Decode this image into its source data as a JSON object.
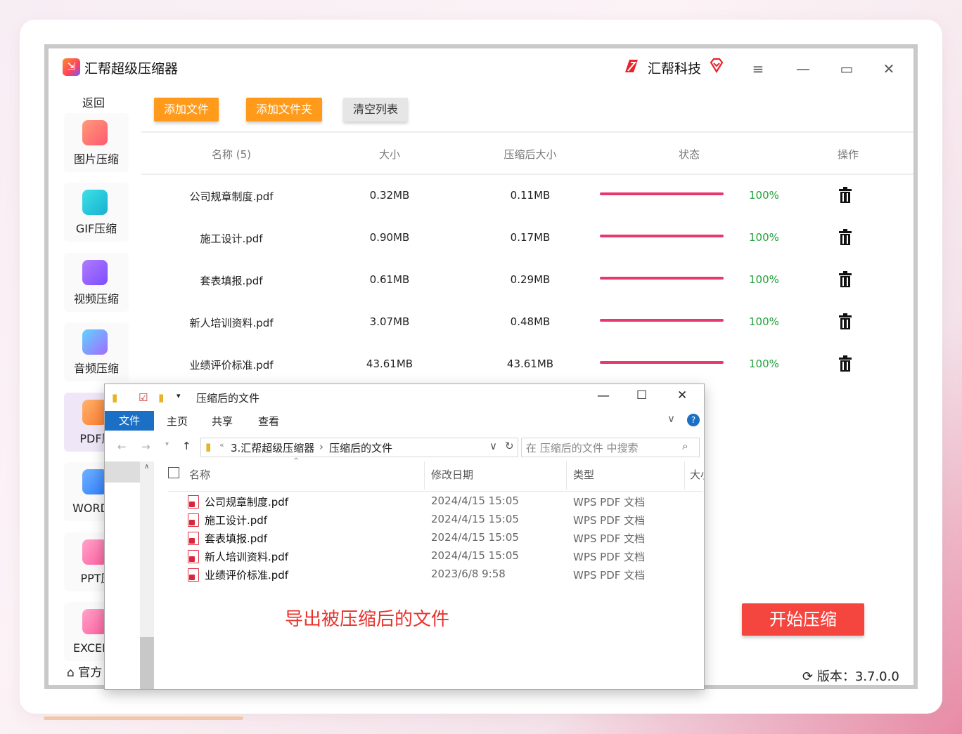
{
  "app": {
    "title": "汇帮超级压缩器",
    "brand": "汇帮科技",
    "back": "返回",
    "home": "官方",
    "version": "版本：3.7.0.0"
  },
  "sidebar": {
    "items": [
      {
        "label": "图片压缩",
        "color": "#ff6b6b"
      },
      {
        "label": "GIF压缩",
        "color": "#22c6d6"
      },
      {
        "label": "视频压缩",
        "color": "#8b5cf6"
      },
      {
        "label": "音频压缩",
        "color": "#6aa9ff"
      },
      {
        "label": "PDF压",
        "color": "#ff8a3d"
      },
      {
        "label": "WORD压",
        "color": "#3a8dff"
      },
      {
        "label": "PPT压",
        "color": "#ff5fa2"
      },
      {
        "label": "EXCEL压",
        "color": "#ff5fa2"
      }
    ]
  },
  "toolbar": {
    "add_file": "添加文件",
    "add_folder": "添加文件夹",
    "clear_list": "清空列表"
  },
  "table": {
    "headers": [
      "名称 (5)",
      "大小",
      "压缩后大小",
      "状态",
      "操作"
    ],
    "rows": [
      {
        "name": "公司规章制度.pdf",
        "size": "0.32MB",
        "compressed": "0.11MB",
        "progress": "100%"
      },
      {
        "name": "施工设计.pdf",
        "size": "0.90MB",
        "compressed": "0.17MB",
        "progress": "100%"
      },
      {
        "name": "套表填报.pdf",
        "size": "0.61MB",
        "compressed": "0.29MB",
        "progress": "100%"
      },
      {
        "name": "新人培训资料.pdf",
        "size": "3.07MB",
        "compressed": "0.48MB",
        "progress": "100%"
      },
      {
        "name": "业绩评价标准.pdf",
        "size": "43.61MB",
        "compressed": "43.61MB",
        "progress": "100%"
      }
    ]
  },
  "start_button": "开始压缩",
  "explorer": {
    "title": "压缩后的文件",
    "tabs": [
      "文件",
      "主页",
      "共享",
      "查看"
    ],
    "path": [
      "3.汇帮超级压缩器",
      "压缩后的文件"
    ],
    "search_placeholder": "在 压缩后的文件 中搜索",
    "columns": [
      "名称",
      "修改日期",
      "类型",
      "大小"
    ],
    "files": [
      {
        "name": "公司规章制度.pdf",
        "date": "2024/4/15 15:05",
        "type": "WPS PDF 文档"
      },
      {
        "name": "施工设计.pdf",
        "date": "2024/4/15 15:05",
        "type": "WPS PDF 文档"
      },
      {
        "name": "套表填报.pdf",
        "date": "2024/4/15 15:05",
        "type": "WPS PDF 文档"
      },
      {
        "name": "新人培训资料.pdf",
        "date": "2024/4/15 15:05",
        "type": "WPS PDF 文档"
      },
      {
        "name": "业绩评价标准.pdf",
        "date": "2023/6/8 9:58",
        "type": "WPS PDF 文档"
      }
    ]
  },
  "annotation": "导出被压缩后的文件"
}
